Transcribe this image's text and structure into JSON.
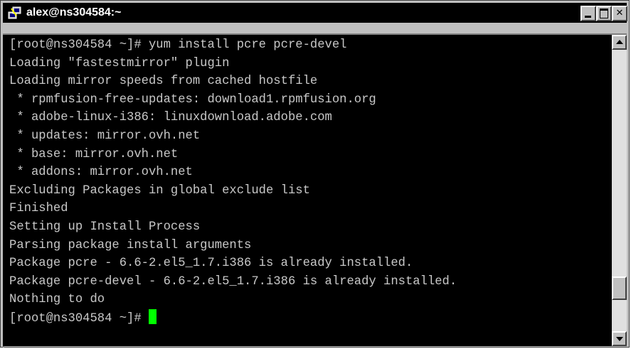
{
  "window": {
    "title": "alex@ns304584:~",
    "icon": "putty-terminal-icon",
    "buttons": {
      "minimize_icon": "minimize-icon",
      "maximize_icon": "maximize-icon",
      "close_icon": "close-icon"
    }
  },
  "terminal": {
    "background": "#000000",
    "foreground": "#c8c8c8",
    "cursor_color": "#00ff00",
    "lines": [
      "[root@ns304584 ~]# yum install pcre pcre-devel",
      "Loading \"fastestmirror\" plugin",
      "Loading mirror speeds from cached hostfile",
      " * rpmfusion-free-updates: download1.rpmfusion.org",
      " * adobe-linux-i386: linuxdownload.adobe.com",
      " * updates: mirror.ovh.net",
      " * base: mirror.ovh.net",
      " * addons: mirror.ovh.net",
      "Excluding Packages in global exclude list",
      "Finished",
      "Setting up Install Process",
      "Parsing package install arguments",
      "Package pcre - 6.6-2.el5_1.7.i386 is already installed.",
      "Package pcre-devel - 6.6-2.el5_1.7.i386 is already installed.",
      "Nothing to do"
    ],
    "prompt": "[root@ns304584 ~]# "
  },
  "scrollbar": {
    "up_icon": "scroll-up-arrow-icon",
    "down_icon": "scroll-down-arrow-icon",
    "position_fraction": 0.88
  }
}
